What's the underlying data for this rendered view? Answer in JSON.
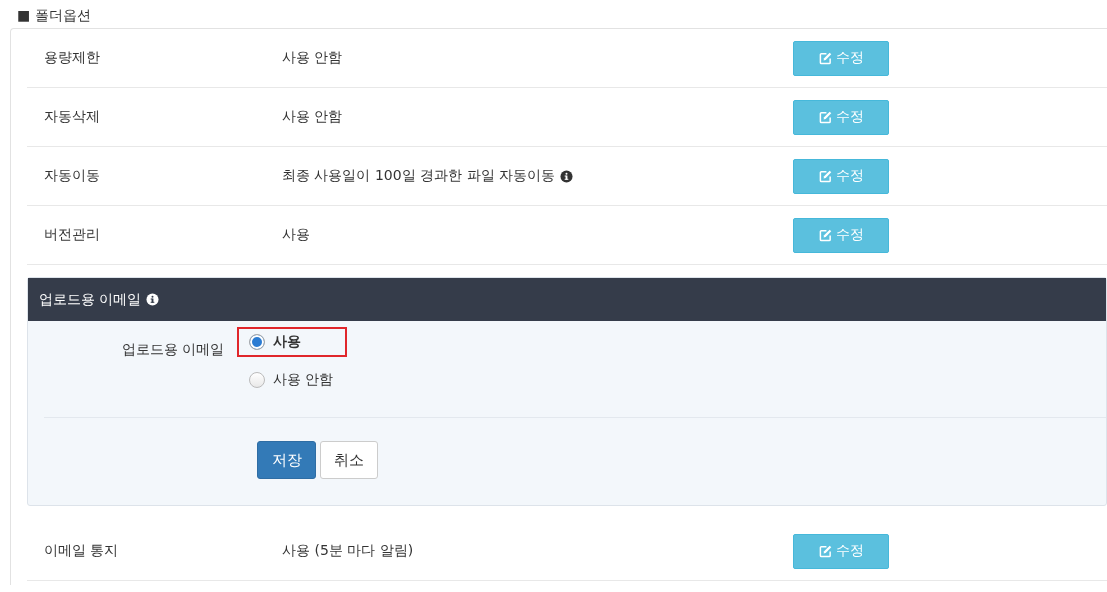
{
  "section_title": "■ 폴더옵션",
  "rows_before": [
    {
      "label": "용량제한",
      "value": "사용 안함",
      "info": false,
      "button": "수정"
    },
    {
      "label": "자동삭제",
      "value": "사용 안함",
      "info": false,
      "button": "수정"
    },
    {
      "label": "자동이동",
      "value": "최종 사용일이 100일 경과한 파일 자동이동",
      "info": true,
      "button": "수정"
    },
    {
      "label": "버전관리",
      "value": "사용",
      "info": false,
      "button": "수정"
    }
  ],
  "editor": {
    "title": "업로드용 이메일",
    "info": true,
    "field_label": "업로드용 이메일",
    "options": [
      {
        "label": "사용",
        "selected": true,
        "highlighted": true
      },
      {
        "label": "사용 안함",
        "selected": false,
        "highlighted": false
      }
    ],
    "save": "저장",
    "cancel": "취소"
  },
  "rows_after": [
    {
      "label": "이메일 통지",
      "value": "사용 (5분 마다 알림)",
      "info": false,
      "button": "수정"
    }
  ]
}
